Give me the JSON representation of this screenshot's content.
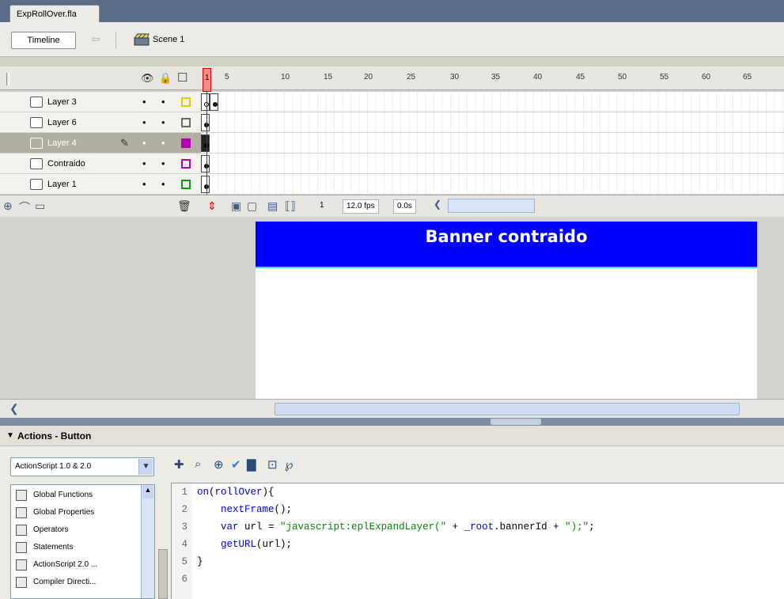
{
  "document": {
    "tab_title": "ExpRollOver.fla"
  },
  "toolbar": {
    "timeline_label": "Timeline",
    "back_icon": "arrow-left-icon",
    "scene_label": "Scene 1"
  },
  "timeline": {
    "ruler_numbers": [
      "1",
      "5",
      "10",
      "15",
      "20",
      "25",
      "30",
      "35",
      "40",
      "45",
      "50",
      "55",
      "60",
      "65"
    ],
    "layers": [
      {
        "name": "Layer 3",
        "outline_color": "#e8c800",
        "selected": false
      },
      {
        "name": "Layer 6",
        "outline_color": "#6a6a6a",
        "selected": false
      },
      {
        "name": "Layer 4",
        "outline_color": "#b000b0",
        "selected": true
      },
      {
        "name": "Contraido",
        "outline_color": "#b000b0",
        "selected": false
      },
      {
        "name": "Layer 1",
        "outline_color": "#00a000",
        "selected": false
      }
    ],
    "footer": {
      "current_frame": "1",
      "fps": "12.0 fps",
      "time": "0.0s"
    }
  },
  "stage": {
    "banner_text": "Banner contraido",
    "banner_color": "#0000ff"
  },
  "actions": {
    "panel_title": "Actions - Button",
    "version_select": "ActionScript 1.0 & 2.0",
    "toolbox": [
      "Global Functions",
      "Global Properties",
      "Operators",
      "Statements",
      "ActionScript 2.0 ...",
      "Compiler Directi..."
    ],
    "code_lines": [
      {
        "n": "1",
        "text": "on(rollOver){"
      },
      {
        "n": "2",
        "text": "    nextFrame();"
      },
      {
        "n": "3",
        "text": "    var url = \"javascript:eplExpandLayer(\" + _root.bannerId + \");\";"
      },
      {
        "n": "4",
        "text": "    getURL(url);"
      },
      {
        "n": "5",
        "text": "}"
      },
      {
        "n": "6",
        "text": ""
      }
    ]
  }
}
